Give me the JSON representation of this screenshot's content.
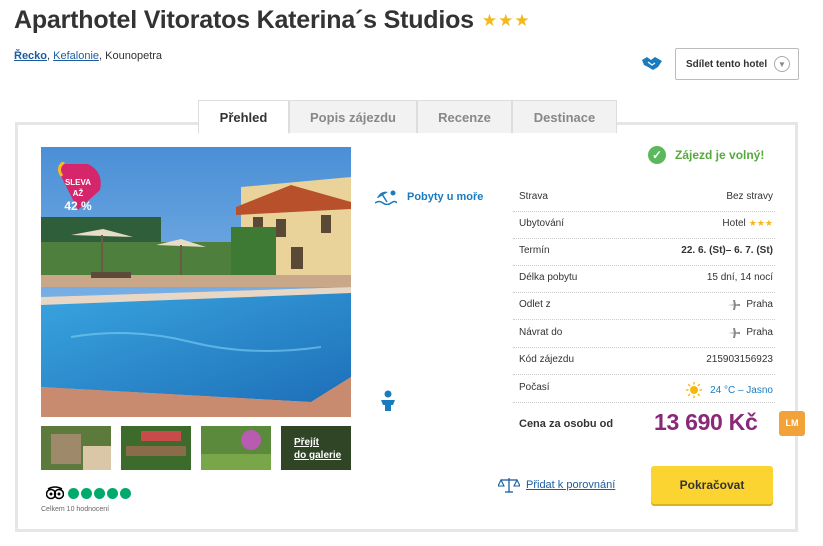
{
  "hotel": {
    "name": "Aparthotel Vitoratos Katerina´s Studios",
    "stars": "★★★"
  },
  "breadcrumb": {
    "country": "Řecko",
    "region": "Kefalonie",
    "place": "Kounopetra"
  },
  "share": {
    "label": "Sdílet tento hotel"
  },
  "tabs": [
    {
      "label": "Přehled"
    },
    {
      "label": "Popis zájezdu"
    },
    {
      "label": "Recenze"
    },
    {
      "label": "Destinace"
    }
  ],
  "badge": {
    "line1": "SLEVA AŽ",
    "line2": "42 %"
  },
  "gallery": {
    "line1": "Přejít",
    "line2": "do galerie"
  },
  "tripadvisor": {
    "rating": 5,
    "count_text": "Celkem 10 hodnocení"
  },
  "category": {
    "label": "Pobyty u moře"
  },
  "availability": {
    "label": "Zájezd je volný!"
  },
  "info": [
    {
      "label": "Strava",
      "value": "Bez stravy"
    },
    {
      "label": "Ubytování",
      "value": "Hotel",
      "stars": "★★★"
    },
    {
      "label": "Termín",
      "value": "22. 6. (St)– 6. 7. (St)"
    },
    {
      "label": "Délka pobytu",
      "value": "15 dní, 14 nocí"
    },
    {
      "label": "Odlet z",
      "value": "Praha"
    },
    {
      "label": "Návrat do",
      "value": "Praha"
    },
    {
      "label": "Kód zájezdu",
      "value": "215903156923"
    },
    {
      "label": "Počasí",
      "value": "24 °C – Jasno"
    }
  ],
  "price": {
    "label": "Cena za osobu od",
    "value": "13 690 Kč",
    "lm": "LM"
  },
  "compare": {
    "label": "Přidat k porovnání"
  },
  "continue": {
    "label": "Pokračovat"
  },
  "colors": {
    "price": "#8b2877",
    "accent_blue": "#1a7bbf",
    "button": "#fcd432",
    "available": "#58a83e"
  }
}
